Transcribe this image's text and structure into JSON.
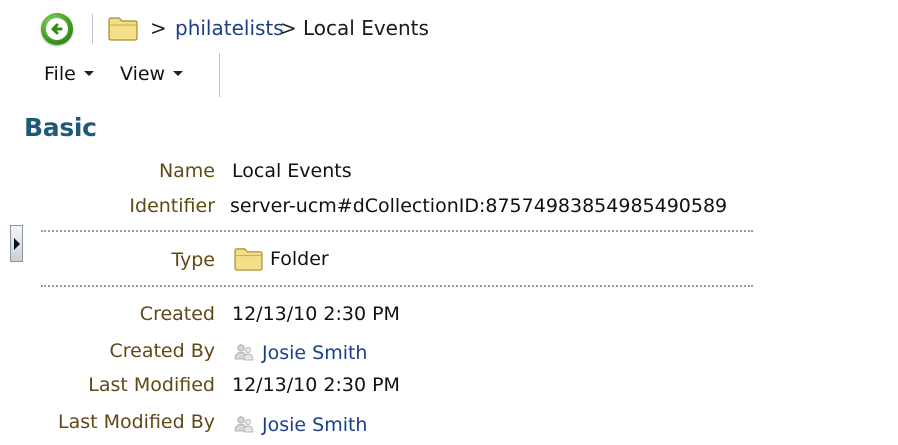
{
  "breadcrumb": {
    "separator": ">",
    "parent_link": "philatelists",
    "current": "Local Events",
    "back_icon": "back-arrow-icon",
    "folder_icon": "folder-icon"
  },
  "menu": {
    "file_label": "File",
    "view_label": "View"
  },
  "section": {
    "title": "Basic"
  },
  "fields": {
    "name": {
      "label": "Name",
      "value": "Local Events"
    },
    "identifier": {
      "label": "Identifier",
      "value": "server-ucm#dCollectionID:875749838549854905​89"
    },
    "type": {
      "label": "Type",
      "value": "Folder"
    },
    "created": {
      "label": "Created",
      "value": "12/13/10 2:30 PM"
    },
    "created_by": {
      "label": "Created By",
      "value": "Josie Smith"
    },
    "last_modified": {
      "label": "Last Modified",
      "value": "12/13/10 2:30 PM"
    },
    "last_modified_by": {
      "label": "Last Modified By",
      "value": "Josie Smith"
    }
  },
  "colors": {
    "link": "#1b3f86",
    "label": "#5f4a16",
    "heading": "#1f5978",
    "back_button": "#3e9d1e"
  }
}
